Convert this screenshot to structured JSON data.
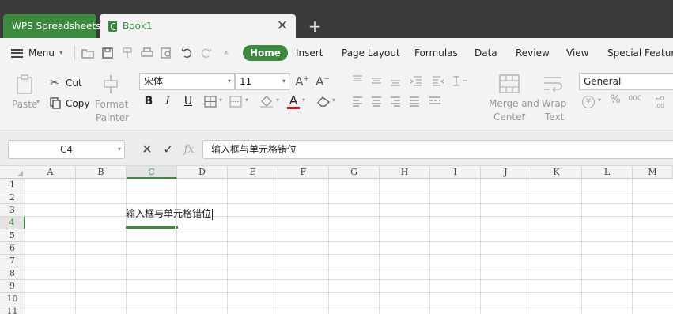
{
  "tabs": {
    "app_label": "WPS Spreadsheets",
    "book_label": "Book1",
    "close_glyph": "✕",
    "new_tab_glyph": "+"
  },
  "menubar": {
    "menu_label": "Menu",
    "tabs": [
      "Home",
      "Insert",
      "Page Layout",
      "Formulas",
      "Data",
      "Review",
      "View",
      "Special Features"
    ],
    "active_tab": "Home"
  },
  "ribbon": {
    "paste_label": "Paste",
    "cut_label": "Cut",
    "copy_label": "Copy",
    "format_painter_line1": "Format",
    "format_painter_line2": "Painter",
    "font_name": "宋体",
    "font_size": "11",
    "bold": "B",
    "italic": "I",
    "underline": "U",
    "merge_line1": "Merge and",
    "merge_line2": "Center",
    "wrap_line1": "Wrap",
    "wrap_line2": "Text",
    "number_format": "General",
    "percent": "%",
    "thousands": "000"
  },
  "formula_bar": {
    "name_box": "C4",
    "fx_label": "fx",
    "content": "输入框与单元格错位"
  },
  "grid": {
    "columns": [
      "A",
      "B",
      "C",
      "D",
      "E",
      "F",
      "G",
      "H",
      "I",
      "J",
      "K",
      "L",
      "M"
    ],
    "rows": [
      "1",
      "2",
      "3",
      "4",
      "5",
      "6",
      "7",
      "8",
      "9",
      "10",
      "11"
    ],
    "selected_column": "C",
    "selected_row": "4",
    "edit_text": "输入框与单元格错位"
  },
  "colors": {
    "accent": "#3b8a3e",
    "tabbar": "#3a3a3a"
  }
}
